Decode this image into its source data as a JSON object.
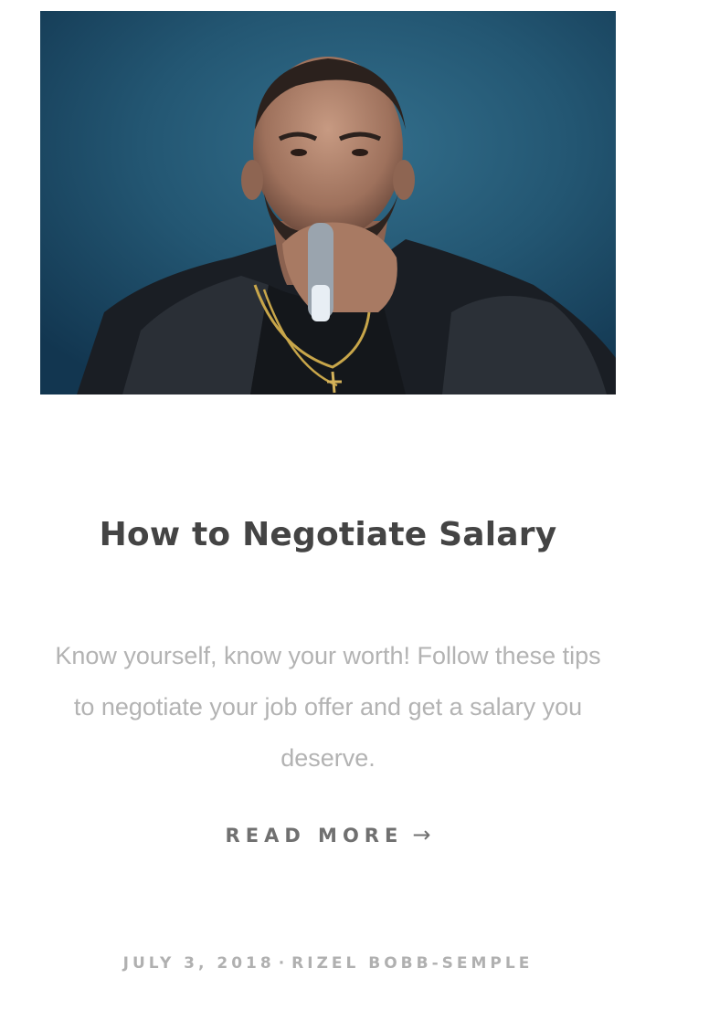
{
  "post": {
    "image_alt": "Performer singing into a microphone",
    "title": "How to Negotiate Salary",
    "excerpt": "Know yourself, know your worth! Follow these tips to negotiate your job offer and get a salary you deserve.",
    "read_more_label": "READ MORE",
    "read_more_icon": "arrow-right-icon",
    "date": "JULY 3, 2018",
    "separator": "·",
    "author": "RIZEL BOBB-SEMPLE"
  },
  "colors": {
    "title": "#444444",
    "excerpt": "#b3b3b3",
    "read_more": "#707070",
    "meta": "#b0b0b0",
    "image_background": "#1f4e68"
  }
}
